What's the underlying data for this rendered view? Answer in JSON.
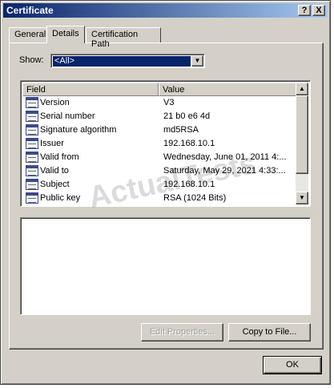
{
  "window": {
    "title": "Certificate"
  },
  "titlebar_buttons": {
    "help": "?",
    "close": "X"
  },
  "tabs": [
    {
      "label": "General"
    },
    {
      "label": "Details",
      "active": true
    },
    {
      "label": "Certification Path"
    }
  ],
  "show": {
    "label": "Show:",
    "selected": "<All>"
  },
  "fields": {
    "columns": [
      "Field",
      "Value"
    ],
    "rows": [
      {
        "field": "Version",
        "value": "V3"
      },
      {
        "field": "Serial number",
        "value": "21 b0 e6 4d"
      },
      {
        "field": "Signature algorithm",
        "value": "md5RSA"
      },
      {
        "field": "Issuer",
        "value": "192.168.10.1"
      },
      {
        "field": "Valid from",
        "value": "Wednesday, June 01, 2011 4:..."
      },
      {
        "field": "Valid to",
        "value": "Saturday, May 29, 2021 4:33:..."
      },
      {
        "field": "Subject",
        "value": "192.168.10.1"
      },
      {
        "field": "Public key",
        "value": "RSA (1024 Bits)"
      }
    ]
  },
  "buttons": {
    "edit_properties": "Edit Properties...",
    "copy_to_file": "Copy to File...",
    "ok": "OK"
  },
  "watermark": "ActualTests"
}
